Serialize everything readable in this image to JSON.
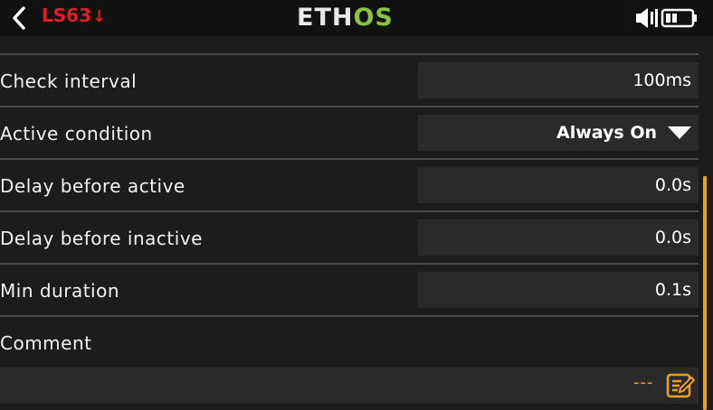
{
  "header": {
    "title": "LS63",
    "title_arrow": "↓",
    "logo_part1": "ETH",
    "logo_part2": "OS"
  },
  "rows": [
    {
      "label": "Check interval",
      "value": "100ms"
    },
    {
      "label": "Active condition",
      "value": "Always On"
    },
    {
      "label": "Delay before active",
      "value": "0.0s"
    },
    {
      "label": "Delay before inactive",
      "value": "0.0s"
    },
    {
      "label": "Min duration",
      "value": "0.1s"
    }
  ],
  "comment": {
    "label": "Comment",
    "placeholder": "---"
  },
  "colors": {
    "accent": "#f0a020",
    "title": "#e02020",
    "logo_os": "#8ac43f"
  },
  "icons": [
    "back-arrow-icon",
    "speaker-icon",
    "battery-icon",
    "dropdown-triangle-icon",
    "edit-icon"
  ]
}
